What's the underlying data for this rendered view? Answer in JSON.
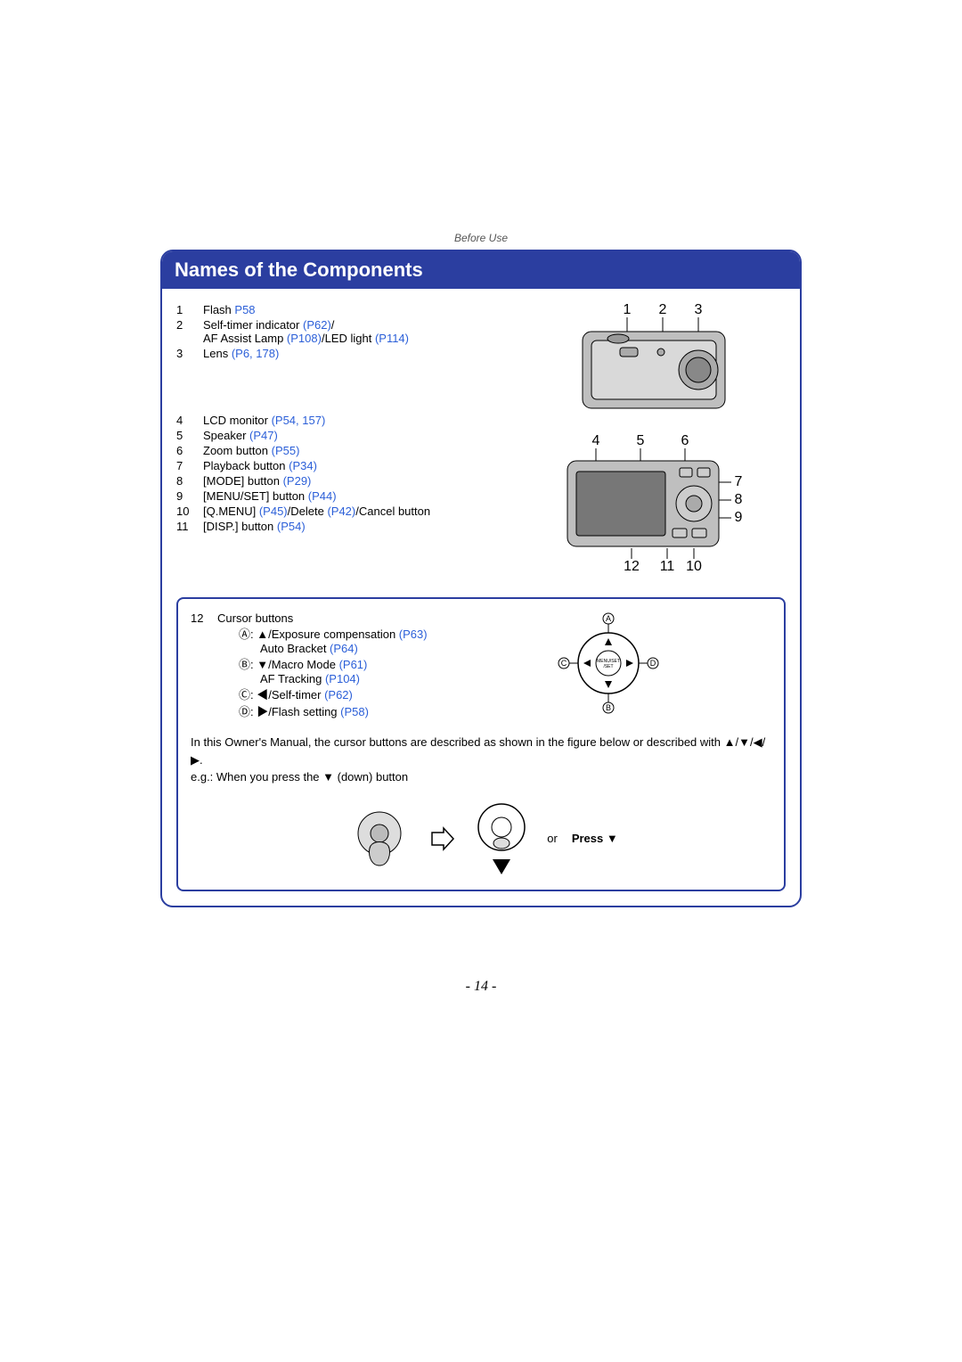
{
  "section_header": "Before Use",
  "title": "Names of the Components",
  "list1": [
    {
      "n": "1",
      "text": "Flash ",
      "refs": [
        {
          "t": "P58"
        }
      ]
    },
    {
      "n": "2",
      "text": "Self-timer indicator ",
      "refs": [
        {
          "t": "(P62)"
        }
      ],
      "after": "/"
    },
    {
      "n": "",
      "text": "AF Assist Lamp ",
      "refs": [
        {
          "t": "(P108)"
        }
      ],
      "after2": "/LED light ",
      "refs2": [
        {
          "t": "(P114)"
        }
      ]
    },
    {
      "n": "3",
      "text": "Lens ",
      "refs": [
        {
          "t": "(P6"
        },
        {
          "t": ", "
        },
        {
          "t": "178)"
        }
      ]
    }
  ],
  "list2": [
    {
      "n": "4",
      "text": "LCD monitor ",
      "refs": [
        {
          "t": "(P54"
        },
        {
          "t": ", "
        },
        {
          "t": "157)"
        }
      ]
    },
    {
      "n": "5",
      "text": "Speaker ",
      "refs": [
        {
          "t": "(P47)"
        }
      ]
    },
    {
      "n": "6",
      "text": "Zoom button ",
      "refs": [
        {
          "t": "(P55)"
        }
      ]
    },
    {
      "n": "7",
      "text": "Playback button ",
      "refs": [
        {
          "t": "(P34)"
        }
      ]
    },
    {
      "n": "8",
      "text": "[MODE] button ",
      "refs": [
        {
          "t": "(P29)"
        }
      ]
    },
    {
      "n": "9",
      "text": "[MENU/SET] button ",
      "refs": [
        {
          "t": "(P44)"
        }
      ]
    },
    {
      "n": "10",
      "text": "[Q.MENU] ",
      "refs": [
        {
          "t": "(P45)"
        }
      ],
      "mid": "/Delete ",
      "refs2": [
        {
          "t": "(P42)"
        }
      ],
      "after": "/Cancel button"
    },
    {
      "n": "11",
      "text": "[DISP.] button ",
      "refs": [
        {
          "t": "(P54)"
        }
      ]
    }
  ],
  "fig_front": {
    "top": [
      "1",
      "2",
      "3"
    ]
  },
  "fig_back": {
    "top": [
      "4",
      "5",
      "6"
    ],
    "right": [
      "7",
      "8",
      "9"
    ],
    "bottom": [
      "12",
      "11",
      "10"
    ]
  },
  "box": {
    "n": "12",
    "title": "Cursor buttons",
    "a": {
      "label": "Ⓐ: ▲/Exposure compensation ",
      "ref": "(P63)",
      "sub2": "Auto Bracket ",
      "ref2": "(P64)"
    },
    "b": {
      "label": "Ⓑ: ▼/Macro Mode ",
      "ref": "(P61)",
      "sub2": "AF Tracking ",
      "ref2": "(P104)"
    },
    "c": {
      "label": "Ⓒ: ◀/Self-timer ",
      "ref": "(P62)"
    },
    "d": {
      "label": "Ⓓ: ▶/Flash setting ",
      "ref": "(P58)"
    },
    "svg_labels": {
      "a": "A",
      "b": "B",
      "c": "C",
      "d": "D",
      "center": "MENU/SET"
    },
    "note1": "In this Owner's Manual, the cursor buttons are described as shown in the figure below or described with ▲/▼/◀/▶.",
    "note2": "e.g.: When you press the ▼ (down) button",
    "or": "or",
    "press": "Press ▼"
  },
  "page": "- 14 -"
}
